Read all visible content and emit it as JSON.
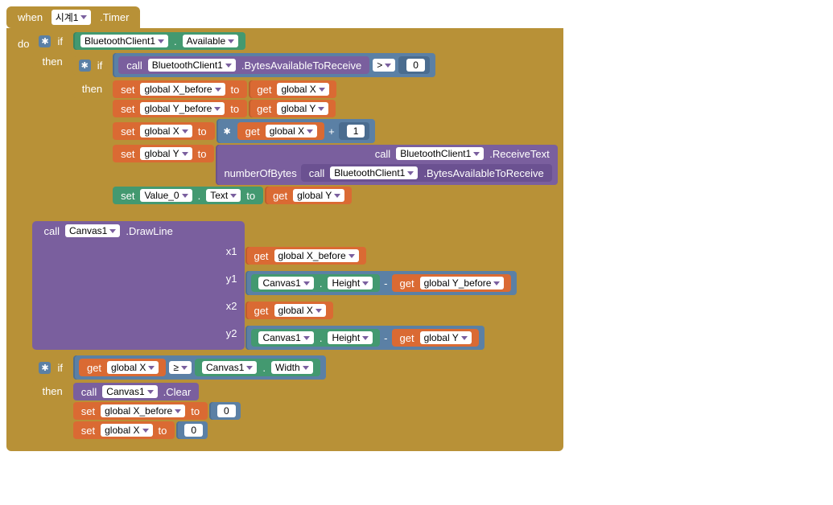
{
  "event": {
    "when": "when",
    "component": "시계1",
    "method": ".Timer",
    "do": "do"
  },
  "if1": {
    "if": "if",
    "then": "then",
    "cond_comp": "BluetoothClient1",
    "dot": ".",
    "cond_prop": "Available"
  },
  "if2": {
    "if": "if",
    "then": "then",
    "call": "call",
    "comp": "BluetoothClient1",
    "method": ".BytesAvailableToReceive",
    "op": ">",
    "zero": "0"
  },
  "s1": {
    "set": "set",
    "var": "global X_before",
    "to": "to",
    "get": "get",
    "g": "global X"
  },
  "s2": {
    "set": "set",
    "var": "global Y_before",
    "to": "to",
    "get": "get",
    "g": "global Y"
  },
  "s3": {
    "set": "set",
    "var": "global X",
    "to": "to",
    "get": "get",
    "g": "global X",
    "plus": "+",
    "one": "1"
  },
  "s4": {
    "set": "set",
    "var": "global Y",
    "to": "to",
    "call": "call",
    "comp": "BluetoothClient1",
    "m": ".ReceiveText",
    "arg": "numberOfBytes",
    "call2": "call",
    "comp2": "BluetoothClient1",
    "m2": ".BytesAvailableToReceive"
  },
  "s5": {
    "set": "set",
    "comp": "Value_0",
    "dot": ".",
    "prop": "Text",
    "to": "to",
    "get": "get",
    "g": "global Y"
  },
  "draw": {
    "call": "call",
    "comp": "Canvas1",
    "m": ".DrawLine",
    "x1": "x1",
    "y1": "y1",
    "x2": "x2",
    "y2": "y2",
    "get": "get",
    "gxb": "global X_before",
    "gyb": "global Y_before",
    "gx": "global X",
    "gy": "global Y",
    "cv": "Canvas1",
    "dot": ".",
    "h": "Height",
    "minus": "-"
  },
  "if3": {
    "if": "if",
    "then": "then",
    "get": "get",
    "gx": "global X",
    "op": "≥",
    "cv": "Canvas1",
    "dot": ".",
    "w": "Width"
  },
  "clr": {
    "call": "call",
    "comp": "Canvas1",
    "m": ".Clear"
  },
  "r1": {
    "set": "set",
    "var": "global X_before",
    "to": "to",
    "z": "0"
  },
  "r2": {
    "set": "set",
    "var": "global X",
    "to": "to",
    "z": "0"
  }
}
